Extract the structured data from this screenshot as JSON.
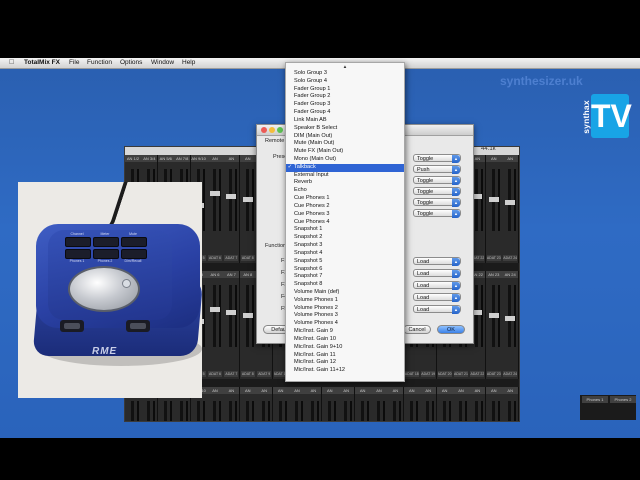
{
  "app": {
    "name": "TotalMix FX",
    "apple_glyph": ""
  },
  "menubar": {
    "items": [
      "File",
      "Function",
      "Options",
      "Window",
      "Help"
    ]
  },
  "watermark": "synthesizer.uk",
  "logo": {
    "vertical_text": "synthax",
    "box_text": "TV"
  },
  "mixer": {
    "title_fragment": "44.1k",
    "top_labels": [
      "AN 1/2",
      "AN 3/4",
      "AN 5/6",
      "AN 7/8",
      "AN 9/10",
      "AN 11/12",
      "AN 13/14",
      "AN 15/16",
      "AN 17/18",
      "AN 19/20",
      "AN 21/22",
      "AN 23/24",
      "AN 25/26",
      "AN 27/28",
      "AN 29/30",
      "AN 31/32",
      "AN 33/34",
      "AN 35/36",
      "AN 37/38",
      "AN 39/40",
      "AN 41/42",
      "AN 43/44",
      "AN 45/46",
      "AN 47/48"
    ],
    "mid_labels": [
      "AN 1",
      "AN 2",
      "AN 3",
      "AN 4",
      "AN 5",
      "AN 6",
      "AN 7",
      "AN 8",
      "AN 9",
      "AN 10",
      "AN 11",
      "AN 12",
      "AN 13",
      "AN 14",
      "AN 15",
      "AN 16",
      "AN 17",
      "AN 18",
      "AN 19",
      "AN 20",
      "AN 21",
      "AN 22",
      "AN 23",
      "AN 24"
    ],
    "foot_labels": [
      "ADAT 1",
      "ADAT 2",
      "ADAT 3",
      "ADAT 4",
      "ADAT 5",
      "ADAT 6",
      "ADAT 7",
      "ADAT 8",
      "ADAT 9",
      "ADAT 10",
      "ADAT 11",
      "ADAT 12",
      "ADAT 13",
      "ADAT 14",
      "ADAT 15",
      "ADAT 16",
      "ADAT 17",
      "ADAT 18",
      "ADAT 19",
      "ADAT 20",
      "ADAT 21",
      "ADAT 22",
      "ADAT 23",
      "ADAT 24"
    ],
    "right_labels": [
      "Phones 1",
      "Phones 2"
    ]
  },
  "settings": {
    "section_label": "Remote",
    "preset_label": "Preset",
    "function_label": "Function Keys",
    "function_keys": [
      "F1",
      "F2",
      "F3",
      "F4",
      "F5",
      "F6"
    ],
    "top_popups": [
      "Toggle",
      "Push",
      "Toggle",
      "Toggle",
      "Toggle",
      "Toggle"
    ],
    "bottom_popups": [
      "Load",
      "Load",
      "Load",
      "Load",
      "Load",
      "Load"
    ],
    "buttons": {
      "default": "Default",
      "cancel": "Cancel",
      "ok": "OK"
    }
  },
  "photo": {
    "device_brand": "RME",
    "button_labels": [
      "Channel",
      "Meter",
      "Mute",
      "Phones 1",
      "Phones 2",
      "Dim/Recall"
    ]
  },
  "dropdown": {
    "scroll_up_glyph": "▲",
    "check_glyph": "✓",
    "selected": "Talkback",
    "items": [
      "Solo Group 3",
      "Solo Group 4",
      "Fader Group 1",
      "Fader Group 2",
      "Fader Group 3",
      "Fader Group 4",
      "Link Main AB",
      "Speaker B Select",
      "DIM (Main Out)",
      "Mute (Main Out)",
      "Mute FX (Main Out)",
      "Mono (Main Out)",
      "Talkback",
      "External Input",
      "Reverb",
      "Echo",
      "Cue Phones 1",
      "Cue Phones 2",
      "Cue Phones 3",
      "Cue Phones 4",
      "Snapshot 1",
      "Snapshot 2",
      "Snapshot 3",
      "Snapshot 4",
      "Snapshot 5",
      "Snapshot 6",
      "Snapshot 7",
      "Snapshot 8",
      "Volume Main (def)",
      "Volume Phones 1",
      "Volume Phones 2",
      "Volume Phones 3",
      "Volume Phones 4",
      "Mic/Inst. Gain 9",
      "Mic/Inst. Gain 10",
      "Mic/Inst. Gain 9+10",
      "Mic/Inst. Gain 11",
      "Mic/Inst. Gain 12",
      "Mic/Inst. Gain 11+12"
    ]
  },
  "colors": {
    "desktop": "#2f6bc4",
    "selection": "#2f64d4",
    "brand_tv": "#18a4e6"
  }
}
